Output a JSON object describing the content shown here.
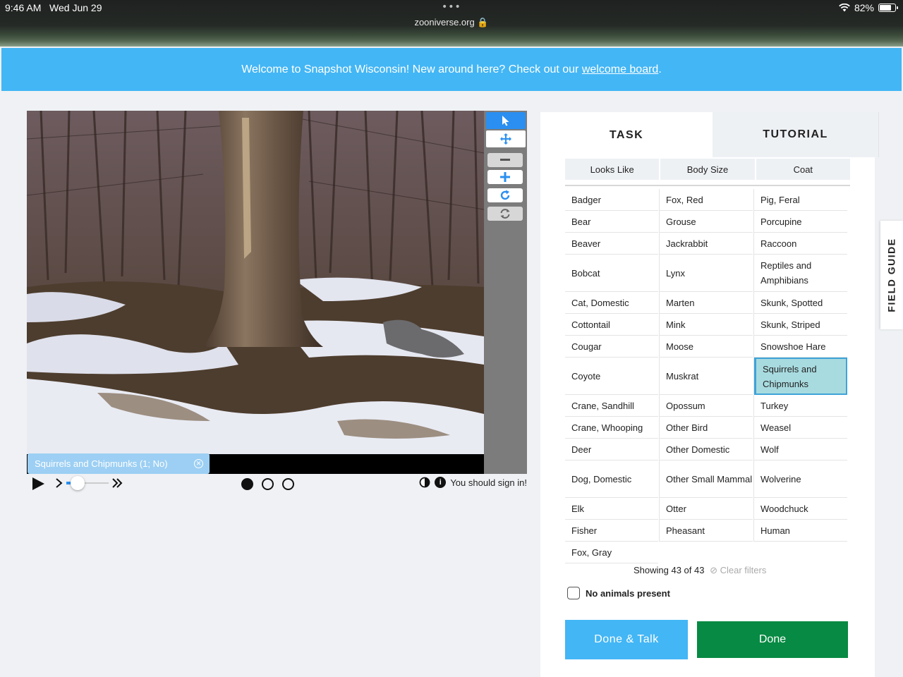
{
  "status_bar": {
    "time": "9:46 AM",
    "date": "Wed Jun 29",
    "url": "zooniverse.org",
    "battery": "82%",
    "battery_level": 0.82
  },
  "banner": {
    "text": "Welcome to Snapshot Wisconsin! New around here? Check out our ",
    "link": "welcome board",
    "suffix": "."
  },
  "viewer": {
    "annotation_tag": "Squirrels and Chipmunks (1; No)",
    "sign_in": "You should sign in!",
    "frames": [
      true,
      false,
      false
    ]
  },
  "task_panel": {
    "tabs": {
      "task": "TASK",
      "tutorial": "TUTORIAL"
    },
    "filters": [
      "Looks Like",
      "Body Size",
      "Coat"
    ],
    "columns": [
      [
        "Badger",
        "Bear",
        "Beaver",
        "Bobcat",
        "Cat, Domestic",
        "Cottontail",
        "Cougar",
        "Coyote",
        "Crane, Sandhill",
        "Crane, Whooping",
        "Deer",
        "Dog, Domestic",
        "Elk",
        "Fisher",
        "Fox, Gray"
      ],
      [
        "Fox, Red",
        "Grouse",
        "Jackrabbit",
        "Lynx",
        "Marten",
        "Mink",
        "Moose",
        "Muskrat",
        "Opossum",
        "Other Bird",
        "Other Domestic",
        "Other Small Mammal",
        "Otter",
        "Pheasant"
      ],
      [
        "Pig, Feral",
        "Porcupine",
        "Raccoon",
        "Reptiles and Amphibians",
        "Skunk, Spotted",
        "Skunk, Striped",
        "Snowshoe Hare",
        "Squirrels and Chipmunks",
        "Turkey",
        "Weasel",
        "Wolf",
        "Wolverine",
        "Woodchuck",
        "Human"
      ]
    ],
    "selected": "Squirrels and Chipmunks",
    "showing": "Showing 43 of 43",
    "clear_filters": "Clear filters",
    "no_animals": "No animals present",
    "done_talk": "Done & Talk",
    "done": "Done"
  },
  "field_guide": "FIELD GUIDE",
  "colors": {
    "banner": "#43b6f5",
    "done": "#078a43",
    "done_talk": "#43b6f5",
    "selected": "#a8dbe0",
    "tool_active": "#2a8ff0"
  }
}
